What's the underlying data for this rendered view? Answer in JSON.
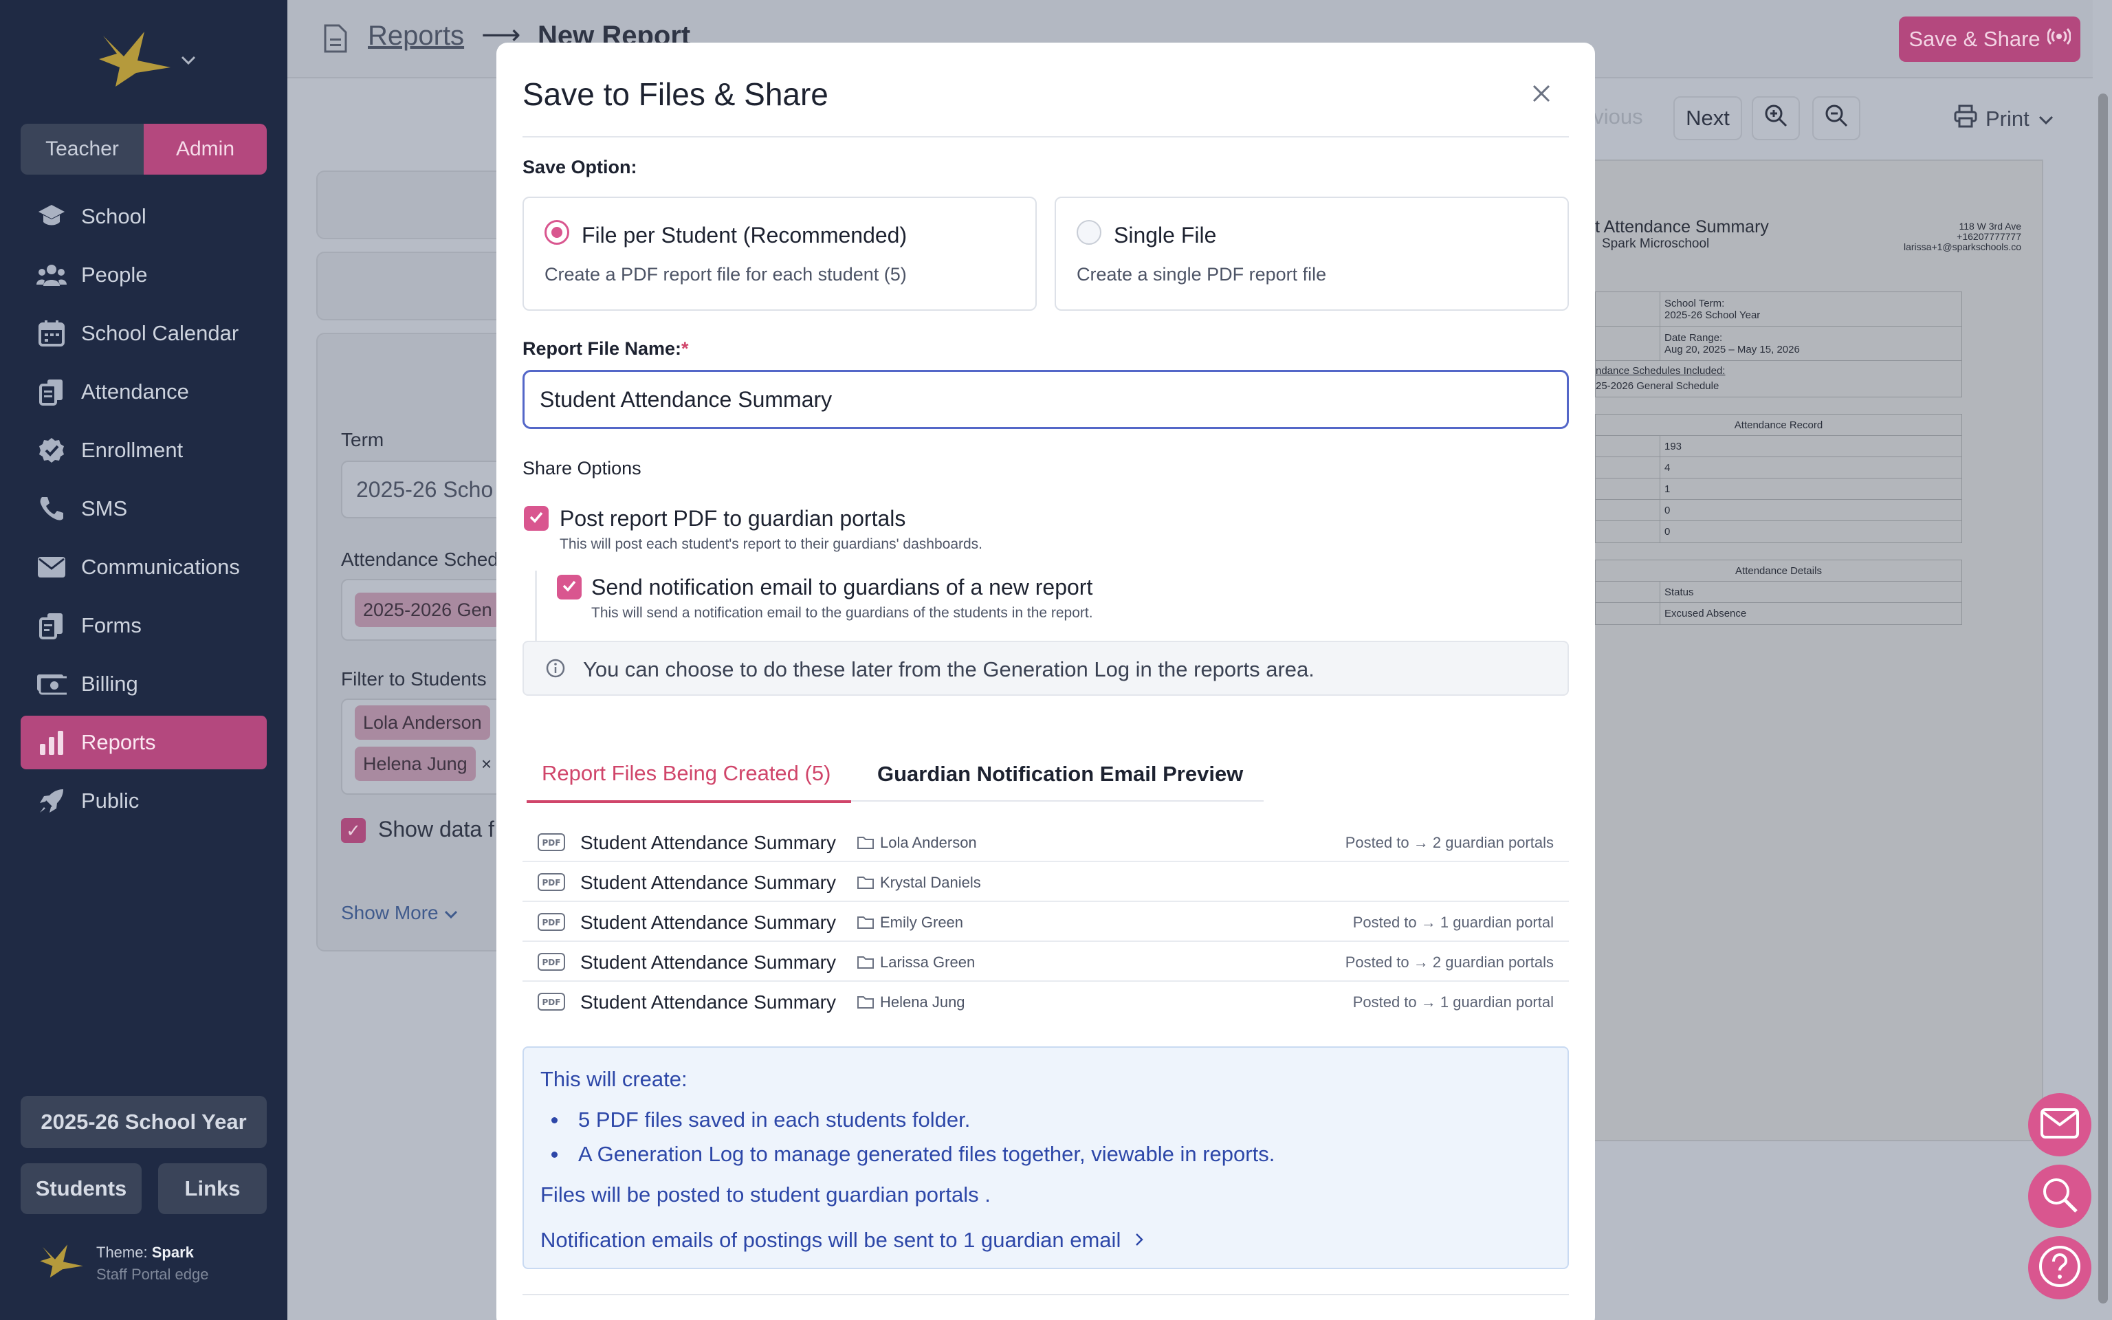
{
  "sidebar": {
    "roles": [
      "Teacher",
      "Admin"
    ],
    "items": [
      {
        "label": "School",
        "icon": "school-icon"
      },
      {
        "label": "People",
        "icon": "people-icon"
      },
      {
        "label": "School Calendar",
        "icon": "calendar-icon"
      },
      {
        "label": "Attendance",
        "icon": "attendance-icon"
      },
      {
        "label": "Enrollment",
        "icon": "enrollment-check-icon"
      },
      {
        "label": "SMS",
        "icon": "phone-icon"
      },
      {
        "label": "Communications",
        "icon": "envelope-icon"
      },
      {
        "label": "Forms",
        "icon": "forms-icon"
      },
      {
        "label": "Billing",
        "icon": "billing-icon"
      },
      {
        "label": "Reports",
        "icon": "bar-chart-icon",
        "active": true
      },
      {
        "label": "Public",
        "icon": "rocket-icon"
      }
    ],
    "year_button": "2025-26 School Year",
    "students_button": "Students",
    "links_button": "Links",
    "theme_prefix": "Theme:",
    "theme_name": "Spark",
    "theme_sub": "Staff Portal edge"
  },
  "header": {
    "crumb_reports": "Reports",
    "crumb_arrow": "⟶",
    "crumb_current": "New Report",
    "save_share": "Save & Share"
  },
  "background_form": {
    "term_label": "Term",
    "term_value": "2025-26 Scho",
    "schedule_label": "Attendance Sched",
    "schedule_chip": "2025-2026 Gen",
    "filter_label": "Filter to Students",
    "filter_chips": [
      "Lola Anderson",
      "Helena Jung"
    ],
    "chip_remove": "×",
    "show_data": "Show data f",
    "show_more": "Show More"
  },
  "preview": {
    "previous": "evious",
    "next": "Next",
    "print": "Print",
    "paper_title": "t Attendance Summary",
    "paper_school": "Spark Microschool",
    "paper_addr": [
      "118 W 3rd Ave",
      "+16207777777",
      "larissa+1@sparkschools.co"
    ],
    "info_rows": [
      "School Term:",
      "2025-26 School Year",
      "Date Range:",
      "Aug 20, 2025 – May 15, 2026",
      "ndance Schedules Included:",
      "25-2026 General Schedule"
    ],
    "record_header": "Attendance Record",
    "record_values": [
      "193",
      "4",
      "1",
      "0",
      "0"
    ],
    "details_header": "Attendance Details",
    "details_col": "Status",
    "details_value": "Excused Absence"
  },
  "modal": {
    "title": "Save to Files & Share",
    "save_option_label": "Save Option:",
    "options": [
      {
        "title": "File per Student (Recommended)",
        "desc": "Create a PDF report file for each student (5)",
        "selected": true
      },
      {
        "title": "Single File",
        "desc": "Create a single PDF report file",
        "selected": false
      }
    ],
    "file_name_label": "Report File Name:",
    "required_mark": "*",
    "file_name_value": "Student Attendance Summary",
    "share_label": "Share Options",
    "post_title": "Post report PDF to guardian portals",
    "post_desc": "This will post each student's report to their guardians' dashboards.",
    "notify_title": "Send notification email to guardians of a new report",
    "notify_desc": "This will send a notification email to the guardians of the students in the report.",
    "info_text": "You can choose to do these later from the Generation Log in the reports area.",
    "tab_files": "Report Files Being Created (5)",
    "tab_preview": "Guardian Notification Email Preview",
    "files": [
      {
        "name": "Student Attendance Summary",
        "student": "Lola Anderson",
        "posted": "Posted to → 2 guardian portals"
      },
      {
        "name": "Student Attendance Summary",
        "student": "Krystal Daniels",
        "posted": ""
      },
      {
        "name": "Student Attendance Summary",
        "student": "Emily Green",
        "posted": "Posted to → 1 guardian portal"
      },
      {
        "name": "Student Attendance Summary",
        "student": "Larissa Green",
        "posted": "Posted to → 2 guardian portals"
      },
      {
        "name": "Student Attendance Summary",
        "student": "Helena Jung",
        "posted": "Posted to → 1 guardian portal"
      }
    ],
    "summary_title": "This will create:",
    "summary_items": [
      "5 PDF files saved in each students folder.",
      "A Generation Log to manage generated files together, viewable in reports."
    ],
    "summary_posted": "Files will be posted to student guardian portals .",
    "summary_notify": "Notification emails of postings will be sent to 1 guardian email"
  },
  "colors": {
    "accent": "#d9568f",
    "sidebar": "#1f2a44",
    "link_blue": "#2d47a8"
  }
}
